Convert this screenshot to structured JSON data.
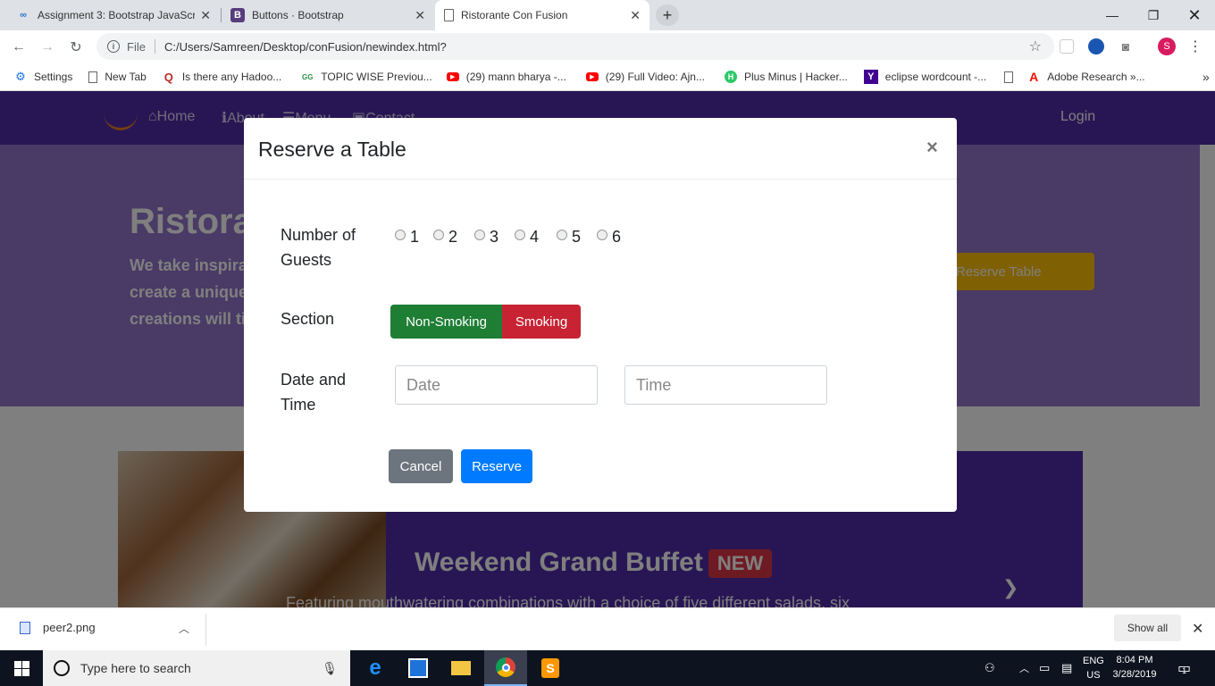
{
  "browser": {
    "tabs": [
      {
        "title": "Assignment 3: Bootstrap JavaScri",
        "icon": "coursera-icon"
      },
      {
        "title": "Buttons · Bootstrap",
        "icon": "bootstrap-icon"
      },
      {
        "title": "Ristorante Con Fusion",
        "icon": "page-icon",
        "active": true
      }
    ],
    "address": {
      "file_label": "File",
      "url": "C:/Users/Samreen/Desktop/conFusion/newindex.html?"
    },
    "avatar_letter": "S",
    "bookmarks": [
      {
        "label": "Settings",
        "icon": "gear-icon"
      },
      {
        "label": "New Tab",
        "icon": "page-icon"
      },
      {
        "label": "Is there any Hadoo...",
        "icon": "quora-icon"
      },
      {
        "label": "TOPIC WISE Previou...",
        "icon": "gfg-icon"
      },
      {
        "label": "(29) mann bharya -...",
        "icon": "youtube-icon"
      },
      {
        "label": "(29) Full Video: Ajn...",
        "icon": "youtube-icon"
      },
      {
        "label": "Plus Minus | Hacker...",
        "icon": "hackerrank-icon"
      },
      {
        "label": "eclipse wordcount -...",
        "icon": "yahoo-icon"
      },
      {
        "label": "",
        "icon": "page-icon"
      },
      {
        "label": "Adobe Research »...",
        "icon": "adobe-icon"
      }
    ],
    "more_bookmarks": "»"
  },
  "site": {
    "nav": {
      "home": "Home",
      "about": "About",
      "menu": "Menu",
      "contact": "Contact",
      "login": "Login"
    },
    "jumbotron": {
      "title": "Ristorante con Fusion",
      "lead_1": "We take inspiration from the World's best cuisines, and",
      "lead_2": "create a unique fusion experience. Our lipsmacking",
      "lead_3": "creations will tickle your culinary senses!",
      "reserve_button": "Reserve Table"
    },
    "carousel": {
      "heading": "Weekend Grand Buffet",
      "badge": "NEW",
      "caption": "Featuring mouthwatering combinations with a choice of five different salads, six"
    }
  },
  "modal": {
    "title": "Reserve a Table",
    "close": "×",
    "guests_label_1": "Number of",
    "guests_label_2": "Guests",
    "guest_options": [
      "1",
      "2",
      "3",
      "4",
      "5",
      "6"
    ],
    "section_label": "Section",
    "non_smoking": "Non-Smoking",
    "smoking": "Smoking",
    "datetime_label_1": "Date and",
    "datetime_label_2": "Time",
    "date_placeholder": "Date",
    "time_placeholder": "Time",
    "cancel": "Cancel",
    "reserve": "Reserve"
  },
  "downloads": {
    "file": "peer2.png",
    "show_all": "Show all"
  },
  "taskbar": {
    "search_placeholder": "Type here to search",
    "lang_1": "ENG",
    "lang_2": "US",
    "time": "8:04 PM",
    "date": "3/28/2019",
    "notification_count": "1"
  },
  "colors": {
    "primary": "#007bff",
    "success": "#1e7e34",
    "danger": "#c82333",
    "secondary": "#6c757d",
    "navbar": "#512da8",
    "jumbotron": "#9575cd"
  }
}
